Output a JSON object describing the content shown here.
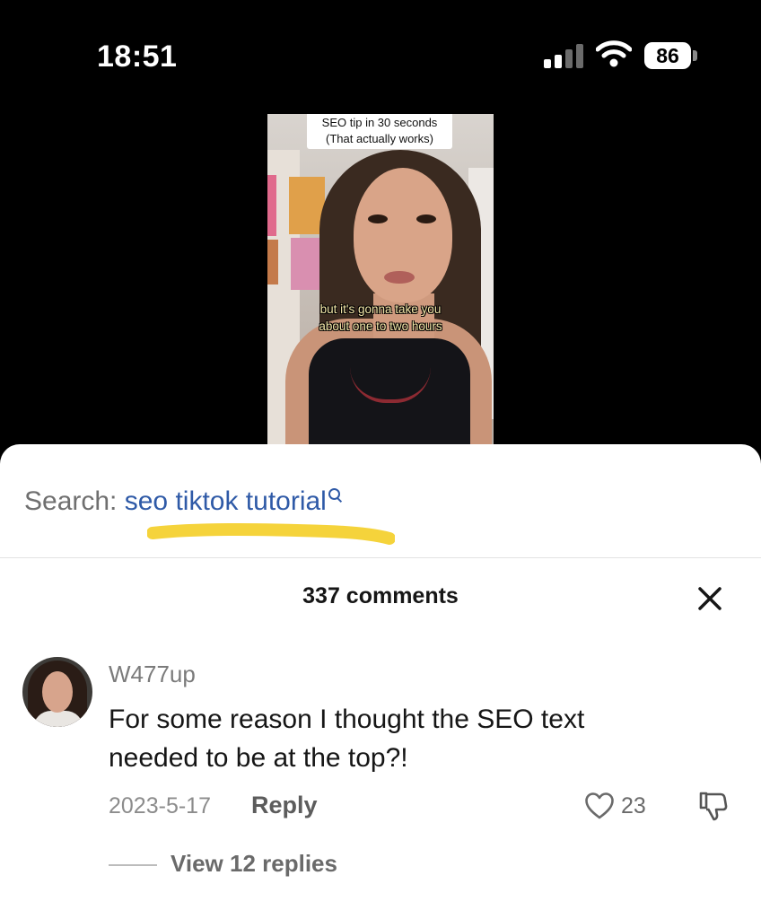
{
  "status_bar": {
    "time": "18:51",
    "battery": "86",
    "icons": [
      "signal-icon",
      "wifi-icon",
      "battery-icon"
    ]
  },
  "video": {
    "title_line1": "SEO tip in 30 seconds",
    "title_line2": "(That actually works)",
    "caption_line1": "but it's gonna take you",
    "caption_line2": "about one to two hours"
  },
  "search": {
    "prefix": "Search: ",
    "term": "seo tiktok tutorial",
    "highlight_color": "#f5d33b",
    "link_color": "#2f5aa7"
  },
  "comments_header": {
    "count_label": "337 comments",
    "close_icon": "close-icon"
  },
  "comment": {
    "username": "W477up",
    "text_line1": "For some reason I thought the SEO text",
    "text_line2": "needed to be at the top?!",
    "date": "2023-5-17",
    "reply_label": "Reply",
    "likes": "23",
    "view_replies_label": "View 12 replies"
  }
}
